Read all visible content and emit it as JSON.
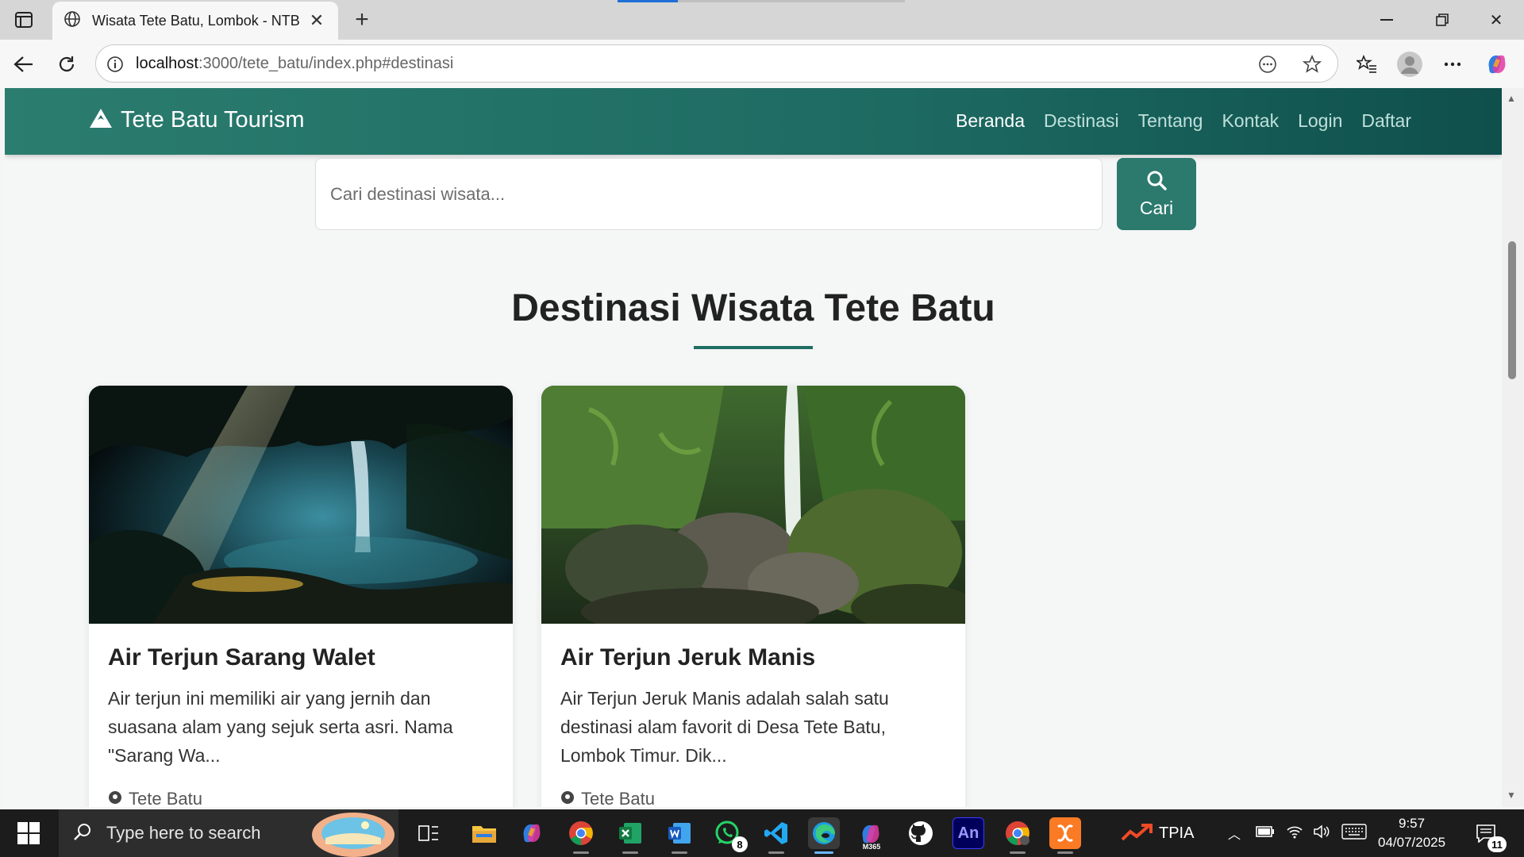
{
  "browser": {
    "tab_title": "Wisata Tete Batu, Lombok - NTB",
    "url_host": "localhost",
    "url_path": ":3000/tete_batu/index.php#destinasi"
  },
  "navbar": {
    "brand": "Tete Batu Tourism",
    "links": [
      {
        "label": "Beranda",
        "active": true
      },
      {
        "label": "Destinasi",
        "active": false
      },
      {
        "label": "Tentang",
        "active": false
      },
      {
        "label": "Kontak",
        "active": false
      },
      {
        "label": "Login",
        "active": false
      },
      {
        "label": "Daftar",
        "active": false
      }
    ]
  },
  "search": {
    "placeholder": "Cari destinasi wisata...",
    "button_label": "Cari"
  },
  "section": {
    "title": "Destinasi Wisata Tete Batu"
  },
  "cards": [
    {
      "title": "Air Terjun Sarang Walet",
      "description": "Air terjun ini memiliki air yang jernih dan suasana alam yang sejuk serta asri. Nama \"Sarang Wa...",
      "location": "Tete Batu",
      "image": "cave-waterfall-photo"
    },
    {
      "title": "Air Terjun Jeruk Manis",
      "description": "Air Terjun Jeruk Manis adalah salah satu destinasi alam favorit di Desa Tete Batu, Lombok Timur. Dik...",
      "location": "Tete Batu",
      "image": "jungle-waterfall-photo"
    }
  ],
  "taskbar": {
    "search_placeholder": "Type here to search",
    "whatsapp_badge": "8",
    "tray_label": "TPIA",
    "time": "9:57",
    "date": "04/07/2025",
    "notification_count": "11",
    "animate_label": "An",
    "m365_label": "M365"
  },
  "colors": {
    "brand_primary": "#2b7a6d",
    "navbar_dark": "#0f4f4c"
  }
}
